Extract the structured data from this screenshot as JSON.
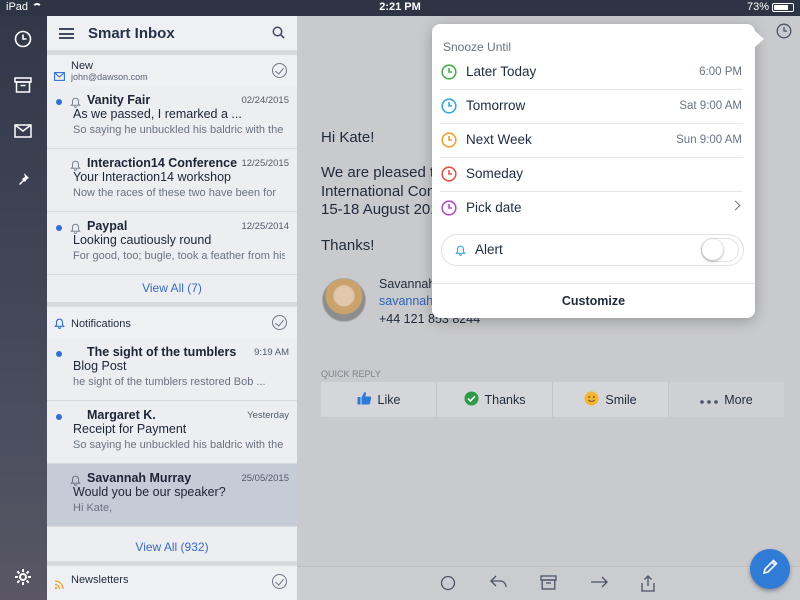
{
  "status_bar": {
    "device": "iPad",
    "time": "2:21 PM",
    "battery": "73%"
  },
  "app": {
    "title": "Smart Inbox"
  },
  "groups": [
    {
      "title": "New",
      "subtitle": "john@dawson.com",
      "messages": [
        {
          "sender": "Vanity Fair",
          "date": "02/24/2015",
          "subject": "As we passed, I remarked a ...",
          "preview": "So saying he unbuckled his baldric with the",
          "unread": true
        },
        {
          "sender": "Interaction14 Conference",
          "date": "12/25/2015",
          "subject": "Your Interaction14 workshop",
          "preview": "Now the races of these two have been for",
          "unread": false
        },
        {
          "sender": "Paypal",
          "date": "12/25/2014",
          "subject": "Looking cautiously round",
          "preview": "For good, too; bugle, took a feather from his",
          "unread": true
        }
      ],
      "view_all": "View All (7)"
    },
    {
      "title": "Notifications",
      "messages": [
        {
          "sender": "The sight of the tumblers",
          "date": "9:19 AM",
          "subject": "Blog Post",
          "preview": "he sight of the tumblers restored Bob ...",
          "unread": true
        },
        {
          "sender": "Margaret K.",
          "date": "Yesterday",
          "subject": "Receipt for Payment",
          "preview": "So saying he unbuckled his baldric with the",
          "unread": true
        },
        {
          "sender": "Savannah Murray",
          "date": "25/05/2015",
          "subject": "Would you be our speaker?",
          "preview": "Hi Kate,",
          "unread": false
        }
      ],
      "view_all": "View All (932)"
    },
    {
      "title": "Newsletters"
    }
  ],
  "email": {
    "greeting": "Hi Kate!",
    "body": "We are pleased t\nInternational Con\n15-18 August 201",
    "closing": "Thanks!",
    "signature": {
      "name": "Savannah",
      "email": "savannah",
      "phone": "+44 121 853 8244"
    }
  },
  "quick_reply": {
    "label": "QUICK REPLY",
    "actions": [
      {
        "label": "Like",
        "icon": "thumbs-up-icon"
      },
      {
        "label": "Thanks",
        "icon": "check-circle-icon"
      },
      {
        "label": "Smile",
        "icon": "smile-icon"
      },
      {
        "label": "More",
        "icon": "more-icon"
      }
    ]
  },
  "snooze": {
    "title": "Snooze Until",
    "options": [
      {
        "label": "Later Today",
        "time": "6:00 PM",
        "color": "#4caf50"
      },
      {
        "label": "Tomorrow",
        "time": "Sat 9:00 AM",
        "color": "#3aa6dc"
      },
      {
        "label": "Next Week",
        "time": "Sun 9:00 AM",
        "color": "#f0a030"
      },
      {
        "label": "Someday",
        "time": "",
        "color": "#e05548"
      },
      {
        "label": "Pick date",
        "time": "",
        "color": "#b24fc4"
      }
    ],
    "alert": {
      "label": "Alert",
      "on": false
    },
    "footer": "Customize"
  },
  "colors": {
    "accent": "#2f7bd6",
    "unread_dot": "#2f6fd1"
  }
}
